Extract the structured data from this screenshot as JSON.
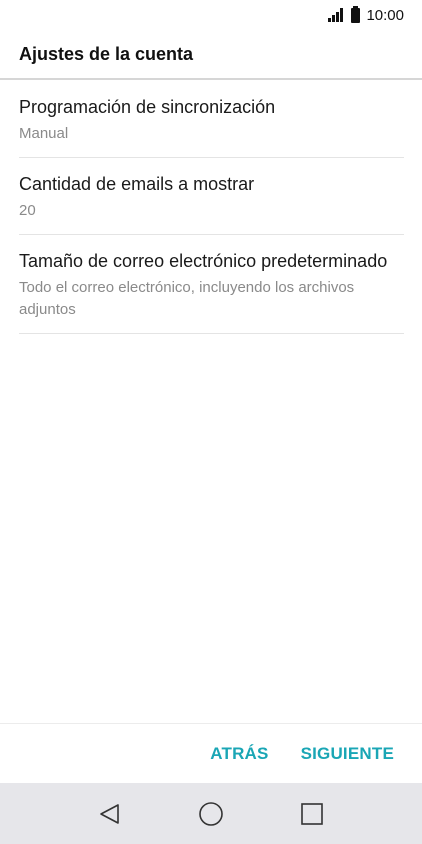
{
  "status_bar": {
    "time": "10:00"
  },
  "header": {
    "title": "Ajustes de la cuenta"
  },
  "settings": [
    {
      "title": "Programación de sincronización",
      "value": "Manual"
    },
    {
      "title": "Cantidad de emails a mostrar",
      "value": "20"
    },
    {
      "title": "Tamaño de correo electrónico predeterminado",
      "value": "Todo el correo electrónico, incluyendo los archivos adjuntos"
    }
  ],
  "actions": {
    "back_label": "ATRÁS",
    "next_label": "SIGUIENTE"
  },
  "nav": {
    "back_icon": "back-triangle-icon",
    "home_icon": "home-circle-icon",
    "recents_icon": "recents-square-icon"
  },
  "colors": {
    "accent": "#1aa6b5",
    "nav_background": "#e6e6ea"
  }
}
